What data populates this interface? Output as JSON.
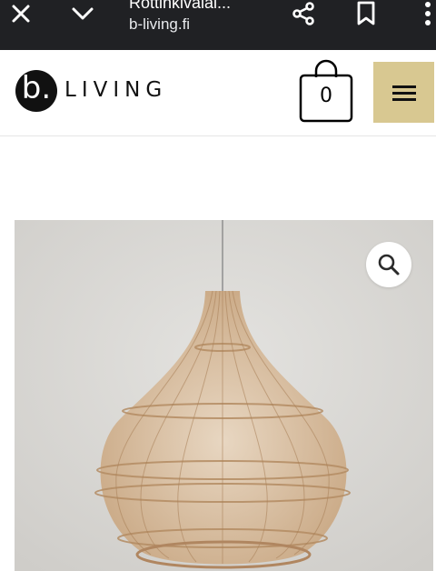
{
  "browser": {
    "title": "Rottinkivalai...",
    "url": "b-living.fi"
  },
  "site": {
    "logo_letter": "b.",
    "logo_text": "LIVING",
    "cart_count": "0"
  },
  "icons": {
    "close": "close-icon",
    "chevron": "chevron-down-icon",
    "share": "share-icon",
    "bookmark": "bookmark-icon",
    "more": "more-vert-icon",
    "cart": "shopping-bag-icon",
    "menu": "hamburger-menu-icon",
    "zoom": "search-icon"
  },
  "colors": {
    "browser_bar": "#202124",
    "menu_button": "#d8c891",
    "logo": "#111111"
  }
}
